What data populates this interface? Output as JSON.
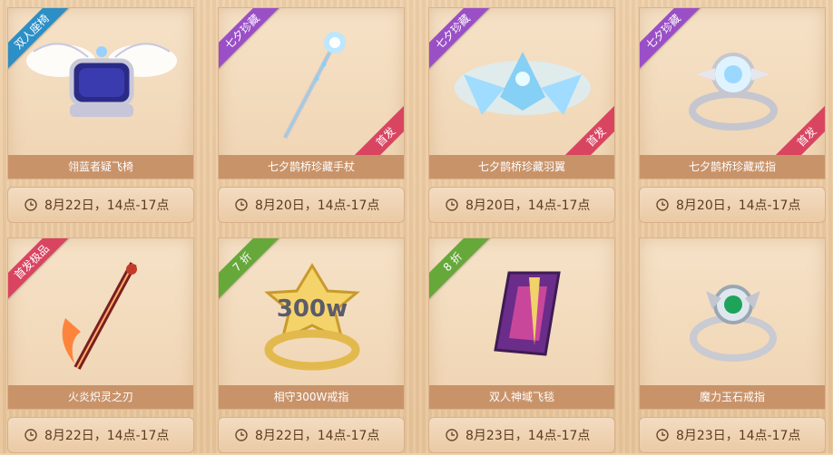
{
  "items": [
    {
      "name": "翎蓝者疑飞椅",
      "time": "8月22日，14点-17点",
      "ribbon": "双人座椅",
      "ribbon_color": "#2c8fc6",
      "corner": ""
    },
    {
      "name": "七夕鹊桥珍藏手杖",
      "time": "8月20日，14点-17点",
      "ribbon": "七夕珍藏",
      "ribbon_color": "#9a4fc6",
      "corner": "首发"
    },
    {
      "name": "七夕鹊桥珍藏羽翼",
      "time": "8月20日，14点-17点",
      "ribbon": "七夕珍藏",
      "ribbon_color": "#9a4fc6",
      "corner": "首发"
    },
    {
      "name": "七夕鹊桥珍藏戒指",
      "time": "8月20日，14点-17点",
      "ribbon": "七夕珍藏",
      "ribbon_color": "#9a4fc6",
      "corner": "首发"
    },
    {
      "name": "火炎炽灵之刃",
      "time": "8月22日，14点-17点",
      "ribbon": "首发极品",
      "ribbon_color": "#d94561",
      "corner": ""
    },
    {
      "name": "相守300W戒指",
      "time": "8月22日，14点-17点",
      "ribbon": "7 折",
      "ribbon_color": "#66a83a",
      "corner": ""
    },
    {
      "name": "双人神域飞毯",
      "time": "8月23日，14点-17点",
      "ribbon": "8 折",
      "ribbon_color": "#66a83a",
      "corner": ""
    },
    {
      "name": "魔力玉石戒指",
      "time": "8月23日，14点-17点",
      "ribbon": "",
      "ribbon_color": "",
      "corner": ""
    }
  ]
}
